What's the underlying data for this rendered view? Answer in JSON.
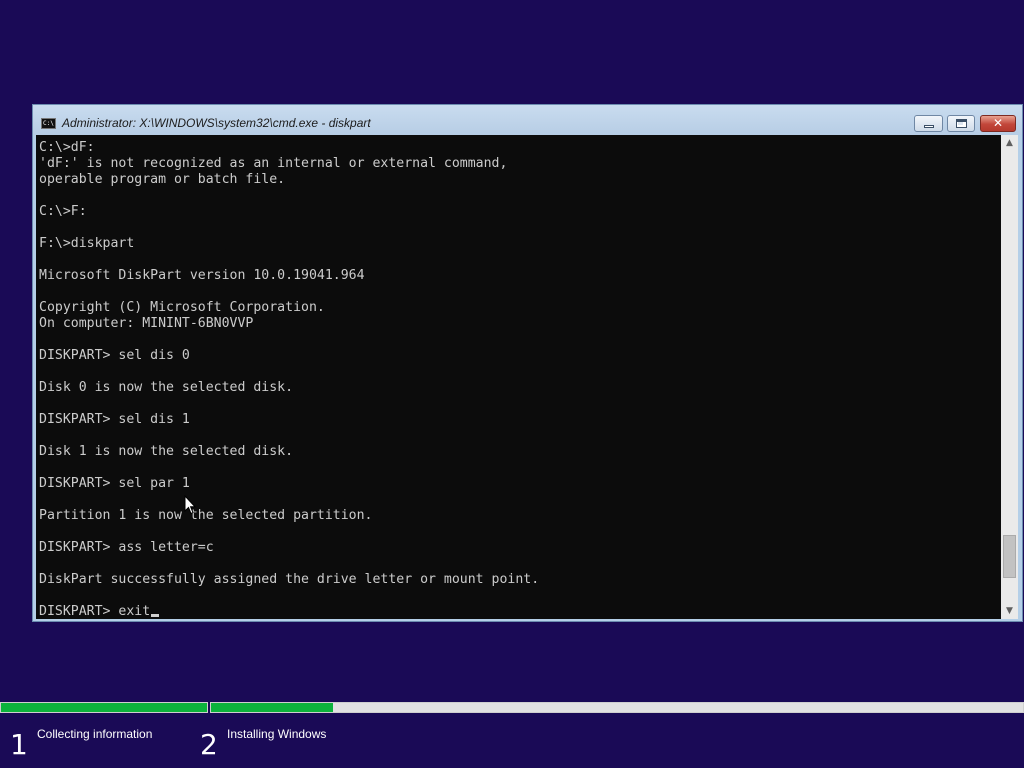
{
  "window": {
    "title": "Administrator: X:\\WINDOWS\\system32\\cmd.exe - diskpart",
    "icon": "cmd-icon",
    "icon_text": "C:\\",
    "close_glyph": "✕"
  },
  "console": {
    "lines": [
      "C:\\>dF:",
      "'dF:' is not recognized as an internal or external command,",
      "operable program or batch file.",
      "",
      "C:\\>F:",
      "",
      "F:\\>diskpart",
      "",
      "Microsoft DiskPart version 10.0.19041.964",
      "",
      "Copyright (C) Microsoft Corporation.",
      "On computer: MININT-6BN0VVP",
      "",
      "DISKPART> sel dis 0",
      "",
      "Disk 0 is now the selected disk.",
      "",
      "DISKPART> sel dis 1",
      "",
      "Disk 1 is now the selected disk.",
      "",
      "DISKPART> sel par 1",
      "",
      "Partition 1 is now the selected partition.",
      "",
      "DISKPART> ass letter=c",
      "",
      "DiskPart successfully assigned the drive letter or mount point.",
      ""
    ],
    "current_input": "DISKPART> exit"
  },
  "scrollbar": {
    "up_arrow": "▲",
    "down_arrow": "▼"
  },
  "setup": {
    "steps": [
      {
        "number": "1",
        "label": "Collecting information",
        "progress": 1.0
      },
      {
        "number": "2",
        "label": "Installing Windows",
        "progress": 0.15
      }
    ]
  },
  "colors": {
    "background": "#1a0a56",
    "console_background": "#0c0c0c",
    "console_text": "#cccccc",
    "progress_fill": "#0db33c",
    "close_button": "#c2463a"
  }
}
